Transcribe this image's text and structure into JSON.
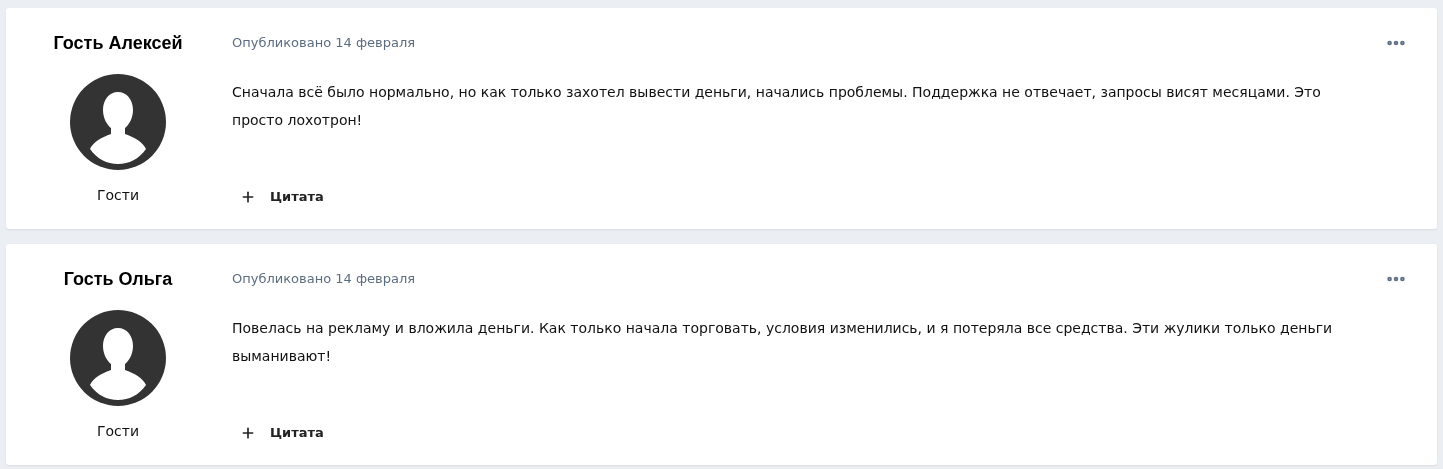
{
  "posts": [
    {
      "author": "Гость Алексей",
      "group": "Гости",
      "date": "Опубликовано 14 февраля",
      "text": "Сначала всё было нормально, но как только захотел вывести деньги, начались проблемы. Поддержка не отвечает, запросы висят месяцами. Это просто лохотрон!",
      "action": "Цитата"
    },
    {
      "author": "Гость Ольга",
      "group": "Гости",
      "date": "Опубликовано 14 февраля",
      "text": "Повелась на рекламу и вложила деньги. Как только начала торговать, условия изменились, и я потеряла все средства. Эти жулики только деньги выманивают!",
      "action": "Цитата"
    }
  ]
}
